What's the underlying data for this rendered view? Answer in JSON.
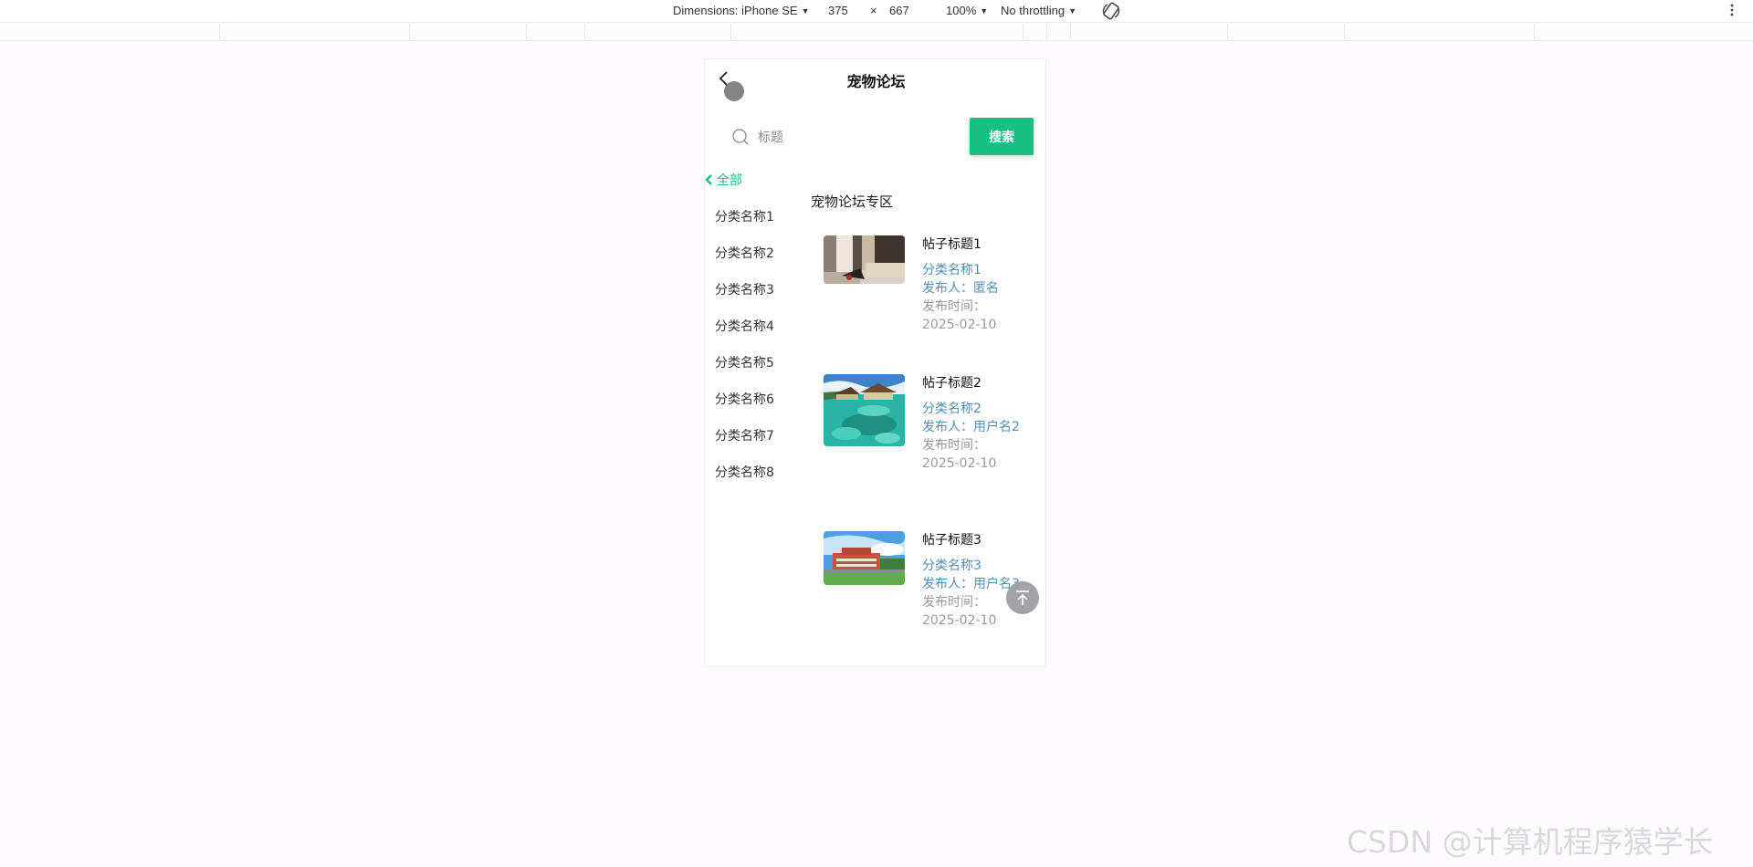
{
  "devtools": {
    "device_label": "Dimensions: iPhone SE",
    "width_value": "375",
    "times": "×",
    "height_value": "667",
    "zoom": "100%",
    "throttling": "No throttling"
  },
  "header": {
    "title": "宠物论坛"
  },
  "search": {
    "placeholder": "标题",
    "button_label": "搜索"
  },
  "sidebar": {
    "all_label": "全部",
    "items": [
      {
        "label": "分类名称1"
      },
      {
        "label": "分类名称2"
      },
      {
        "label": "分类名称3"
      },
      {
        "label": "分类名称4"
      },
      {
        "label": "分类名称5"
      },
      {
        "label": "分类名称6"
      },
      {
        "label": "分类名称7"
      },
      {
        "label": "分类名称8"
      }
    ]
  },
  "main": {
    "zone_title": "宠物论坛专区",
    "posts": [
      {
        "title": "帖子标题1",
        "category": "分类名称1",
        "author_line": "发布人：匿名",
        "time_label": "发布时间：",
        "time": "2025-02-10"
      },
      {
        "title": "帖子标题2",
        "category": "分类名称2",
        "author_line": "发布人：用户名2",
        "time_label": "发布时间：",
        "time": "2025-02-10"
      },
      {
        "title": "帖子标题3",
        "category": "分类名称3",
        "author_line": "发布人：用户名3",
        "time_label": "发布时间：",
        "time": "2025-02-10"
      }
    ]
  },
  "colors": {
    "accent": "#19be83",
    "link": "#4f8fb8",
    "muted": "#999999"
  },
  "icons": [
    "back-icon",
    "search-icon",
    "chevron-left-icon",
    "back-to-top-icon",
    "rotate-icon",
    "more-vert-icon"
  ],
  "watermark": "CSDN @计算机程序猿学长"
}
